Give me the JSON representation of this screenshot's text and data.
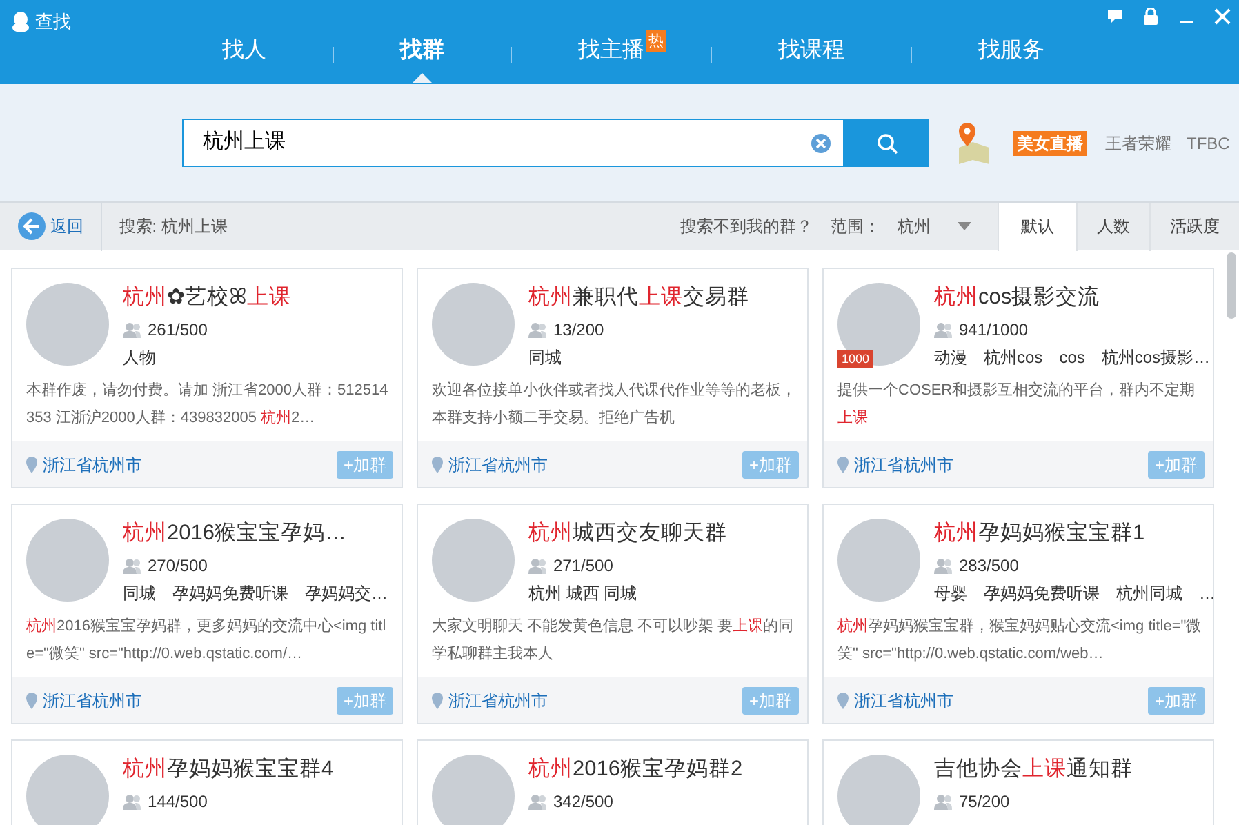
{
  "window": {
    "title": "查找"
  },
  "tabs": [
    {
      "label": "找人",
      "selected": false
    },
    {
      "label": "找群",
      "selected": true
    },
    {
      "label": "找主播",
      "selected": false,
      "badge": "热"
    },
    {
      "label": "找课程",
      "selected": false
    },
    {
      "label": "找服务",
      "selected": false
    }
  ],
  "search": {
    "value": "杭州上课",
    "hot": [
      {
        "label": "美女直播",
        "featured": true
      },
      {
        "label": "王者荣耀",
        "featured": false
      },
      {
        "label": "TFBC",
        "featured": false
      }
    ]
  },
  "toolbar": {
    "back": "返回",
    "query": "搜索: 杭州上课",
    "help": "搜索不到我的群？",
    "range_label": "范围：",
    "range_value": "杭州",
    "sorts": [
      {
        "label": "默认",
        "selected": true
      },
      {
        "label": "人数",
        "selected": false
      },
      {
        "label": "活跃度",
        "selected": false
      }
    ]
  },
  "groups": [
    {
      "title": [
        {
          "text": "杭州",
          "hit": true
        },
        {
          "text": "✿艺校ꕤ",
          "hit": false
        },
        {
          "text": "上课",
          "hit": true
        }
      ],
      "members": "261/500",
      "tags": [
        "人物"
      ],
      "description": [
        {
          "text": "本群作废，请勿付费。请加 浙江省2000人群：512514353 江浙沪2000人群：439832005 ",
          "hit": false
        },
        {
          "text": "杭州",
          "hit": true
        },
        {
          "text": "2…",
          "hit": false
        }
      ],
      "location": "浙江省杭州市",
      "join": "+加群"
    },
    {
      "title": [
        {
          "text": "杭州",
          "hit": true
        },
        {
          "text": "兼职代",
          "hit": false
        },
        {
          "text": "上课",
          "hit": true
        },
        {
          "text": "交易群",
          "hit": false
        }
      ],
      "members": "13/200",
      "tags": [
        "同城"
      ],
      "description": [
        {
          "text": "欢迎各位接单小伙伴或者找人代课代作业等等的老板，本群支持小额二手交易。拒绝广告机",
          "hit": false
        }
      ],
      "location": "浙江省杭州市",
      "join": "+加群"
    },
    {
      "title": [
        {
          "text": "杭州",
          "hit": true
        },
        {
          "text": "cos摄影交流",
          "hit": false
        }
      ],
      "members": "941/1000",
      "avatar_badge": "1000",
      "tags": [
        "动漫",
        "杭州cos",
        "cos",
        "杭州cos摄影…"
      ],
      "description": [
        {
          "text": "提供一个COSER和摄影互相交流的平台，群内不定期",
          "hit": false
        },
        {
          "text": "上课",
          "hit": true
        }
      ],
      "location": "浙江省杭州市",
      "join": "+加群"
    },
    {
      "title": [
        {
          "text": "杭州",
          "hit": true
        },
        {
          "text": "2016猴宝宝孕妈…",
          "hit": false
        }
      ],
      "members": "270/500",
      "tags": [
        "同城",
        "孕妈妈免费听课",
        "孕妈妈交…"
      ],
      "description": [
        {
          "text": "杭州",
          "hit": true
        },
        {
          "text": "2016猴宝宝孕妈群，更多妈妈的交流中心<img title=\"微笑\" src=\"http://0.web.qstatic.com/…",
          "hit": false
        }
      ],
      "location": "浙江省杭州市",
      "join": "+加群"
    },
    {
      "title": [
        {
          "text": "杭州",
          "hit": true
        },
        {
          "text": "城西交友聊天群",
          "hit": false
        }
      ],
      "members": "271/500",
      "tags": [
        "杭州 城西 同城"
      ],
      "description": [
        {
          "text": "大家文明聊天 不能发黄色信息 不可以吵架 要",
          "hit": false
        },
        {
          "text": "上课",
          "hit": true
        },
        {
          "text": "的同学私聊群主我本人",
          "hit": false
        }
      ],
      "location": "浙江省杭州市",
      "join": "+加群"
    },
    {
      "title": [
        {
          "text": "杭州",
          "hit": true
        },
        {
          "text": "孕妈妈猴宝宝群1",
          "hit": false
        }
      ],
      "members": "283/500",
      "tags": [
        "母婴",
        "孕妈妈免费听课",
        "杭州同城",
        "…"
      ],
      "description": [
        {
          "text": "杭州",
          "hit": true
        },
        {
          "text": "孕妈妈猴宝宝群，猴宝妈妈贴心交流<img title=\"微笑\" src=\"http://0.web.qstatic.com/web…",
          "hit": false
        }
      ],
      "location": "浙江省杭州市",
      "join": "+加群"
    },
    {
      "title": [
        {
          "text": "杭州",
          "hit": true
        },
        {
          "text": "孕妈妈猴宝宝群4",
          "hit": false
        }
      ],
      "members": "144/500"
    },
    {
      "title": [
        {
          "text": "杭州",
          "hit": true
        },
        {
          "text": "2016猴宝孕妈群2",
          "hit": false
        }
      ],
      "members": "342/500"
    },
    {
      "title": [
        {
          "text": "吉他协会",
          "hit": false
        },
        {
          "text": "上课",
          "hit": true
        },
        {
          "text": "通知群",
          "hit": false
        }
      ],
      "members": "75/200"
    }
  ]
}
